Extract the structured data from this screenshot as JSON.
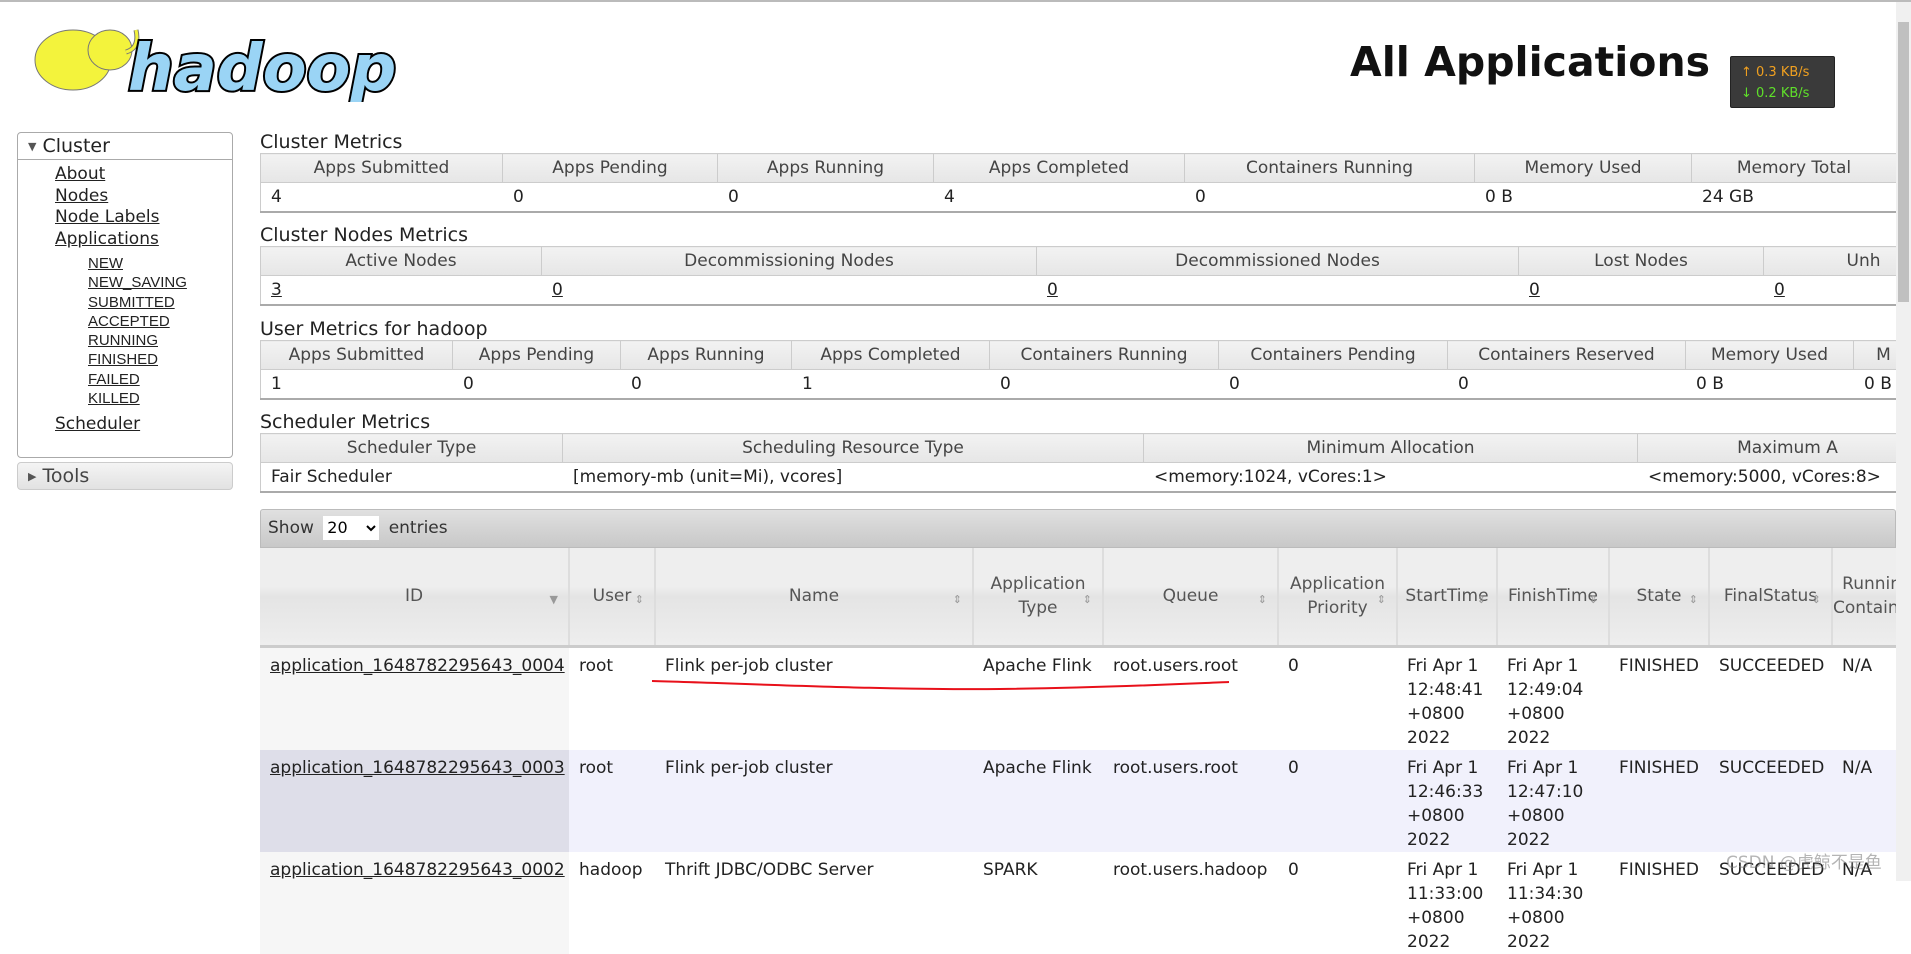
{
  "logo": {
    "text": "hadoop",
    "colors": {
      "elephant": "#f3f33c",
      "text": "#9ad4f5"
    }
  },
  "header": {
    "title": "All Applications"
  },
  "net_speed": {
    "up": "↑ 0.3 KB/s",
    "down": "↓ 0.2 KB/s"
  },
  "sidebar": {
    "cluster": {
      "label": "Cluster",
      "items": [
        "About",
        "Nodes",
        "Node Labels",
        "Applications"
      ],
      "app_states": [
        "NEW",
        "NEW_SAVING",
        "SUBMITTED",
        "ACCEPTED",
        "RUNNING",
        "FINISHED",
        "FAILED",
        "KILLED"
      ],
      "scheduler": "Scheduler"
    },
    "tools": {
      "label": "Tools"
    }
  },
  "cluster_metrics": {
    "title": "Cluster Metrics",
    "headers": [
      "Apps Submitted",
      "Apps Pending",
      "Apps Running",
      "Apps Completed",
      "Containers Running",
      "Memory Used",
      "Memory Total"
    ],
    "values": [
      "4",
      "0",
      "0",
      "4",
      "0",
      "0 B",
      "24 GB"
    ]
  },
  "cluster_nodes_metrics": {
    "title": "Cluster Nodes Metrics",
    "headers": [
      "Active Nodes",
      "Decommissioning Nodes",
      "Decommissioned Nodes",
      "Lost Nodes",
      "Unh"
    ],
    "values": [
      "3",
      "0",
      "0",
      "0",
      "0"
    ]
  },
  "user_metrics": {
    "title": "User Metrics for hadoop",
    "headers": [
      "Apps Submitted",
      "Apps Pending",
      "Apps Running",
      "Apps Completed",
      "Containers Running",
      "Containers Pending",
      "Containers Reserved",
      "Memory Used",
      "M"
    ],
    "values": [
      "1",
      "0",
      "0",
      "1",
      "0",
      "0",
      "0",
      "0 B",
      "0 B"
    ]
  },
  "scheduler_metrics": {
    "title": "Scheduler Metrics",
    "headers": [
      "Scheduler Type",
      "Scheduling Resource Type",
      "Minimum Allocation",
      "Maximum A"
    ],
    "values": [
      "Fair Scheduler",
      "[memory-mb (unit=Mi), vcores]",
      "<memory:1024, vCores:1>",
      "<memory:5000, vCores:8>"
    ]
  },
  "apps_table": {
    "show_label": "Show",
    "entries_label": "entries",
    "page_size": "20",
    "headers": [
      "ID",
      "User",
      "Name",
      "Application Type",
      "Queue",
      "Application Priority",
      "StartTime",
      "FinishTime",
      "State",
      "FinalStatus",
      "Running Containers"
    ],
    "rows": [
      [
        "application_1648782295643_0004",
        "root",
        "Flink per-job cluster",
        "Apache Flink",
        "root.users.root",
        "0",
        "Fri Apr 1 12:48:41 +0800 2022",
        "Fri Apr 1 12:49:04 +0800 2022",
        "FINISHED",
        "SUCCEEDED",
        "N/A"
      ],
      [
        "application_1648782295643_0003",
        "root",
        "Flink per-job cluster",
        "Apache Flink",
        "root.users.root",
        "0",
        "Fri Apr 1 12:46:33 +0800 2022",
        "Fri Apr 1 12:47:10 +0800 2022",
        "FINISHED",
        "SUCCEEDED",
        "N/A"
      ],
      [
        "application_1648782295643_0002",
        "hadoop",
        "Thrift JDBC/ODBC Server",
        "SPARK",
        "root.users.hadoop",
        "0",
        "Fri Apr 1 11:33:00 +0800 2022",
        "Fri Apr 1 11:34:30 +0800 2022",
        "FINISHED",
        "SUCCEEDED",
        "N/A"
      ]
    ]
  },
  "annotation": {
    "color": "#e8101a"
  },
  "watermark": "CSDN @虎鲸不是鱼"
}
